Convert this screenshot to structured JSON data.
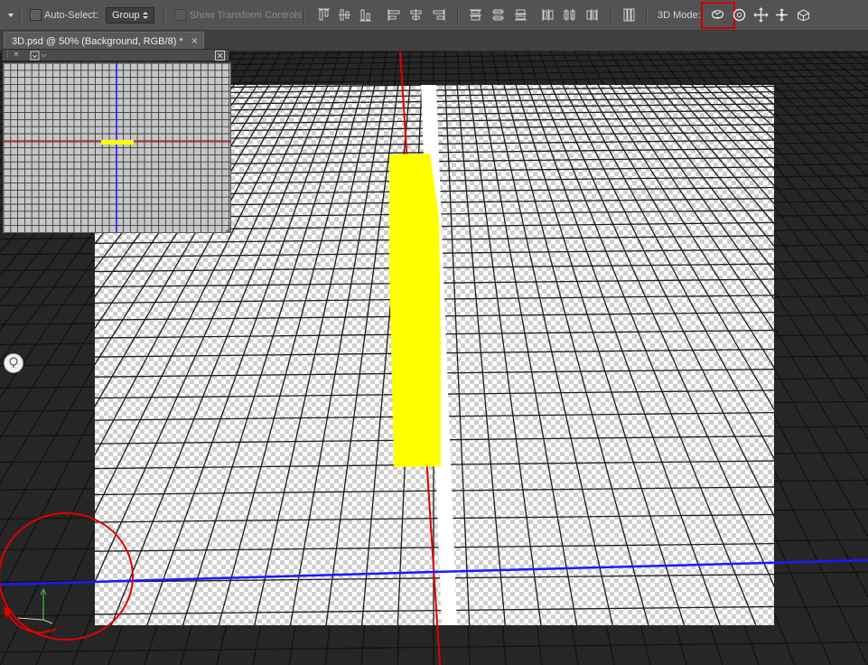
{
  "options_bar": {
    "auto_select_label": "Auto-Select:",
    "group_value": "Group",
    "show_transform_label": "Show Transform Controls",
    "mode_label": "3D Mode:",
    "mode_icons": [
      "rotate-3d-icon",
      "roll-3d-icon",
      "drag-3d-icon",
      "slide-3d-icon",
      "scale-3d-icon"
    ],
    "align_icons": [
      "align-top-icon",
      "align-vcenter-icon",
      "align-bottom-icon",
      "align-left-icon",
      "align-hcenter-icon",
      "align-right-icon"
    ],
    "distribute_icons": [
      "distribute-top-icon",
      "distribute-vcenter-icon",
      "distribute-bottom-icon",
      "distribute-left-icon",
      "distribute-hcenter-icon",
      "distribute-right-icon"
    ],
    "auto_align_icon": "auto-align-icon",
    "highlight_color": "#d00000"
  },
  "document": {
    "tab_title": "3D.psd @ 50% (Background, RGB/8) *",
    "close_glyph": "×"
  },
  "secondary_view": {
    "close_glyph": "×",
    "icons": [
      "pin-icon",
      "view-select-icon",
      "expand-icon"
    ]
  },
  "scene": {
    "plane_color": "#ffffff",
    "object_color": "#ffff00",
    "x_axis_color": "#1a1aff",
    "y_axis_color": "#e00000",
    "annotation_color": "#e00000"
  }
}
